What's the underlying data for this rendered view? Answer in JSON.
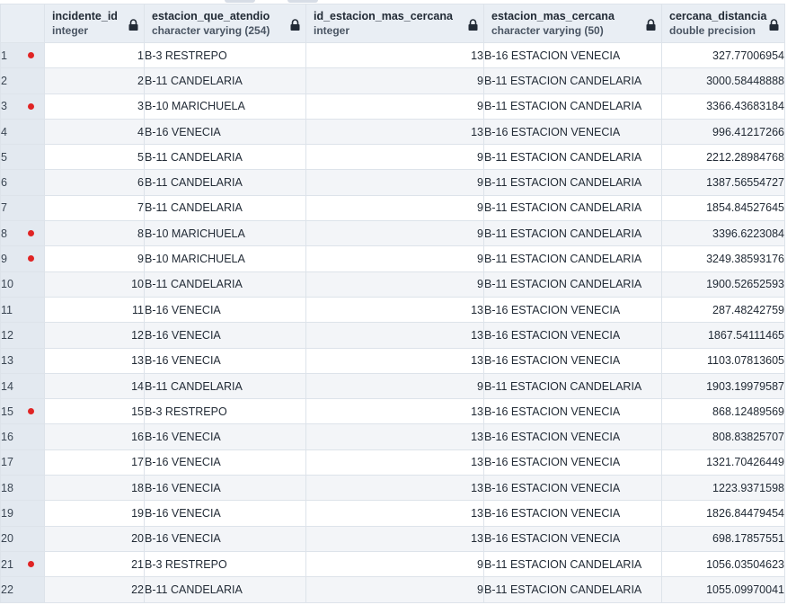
{
  "columns": [
    {
      "name": "incidente_id",
      "type": "integer"
    },
    {
      "name": "estacion_que_atendio",
      "type": "character varying (254)"
    },
    {
      "name": "id_estacion_mas_cercana",
      "type": "integer"
    },
    {
      "name": "estacion_mas_cercana",
      "type": "character varying (50)"
    },
    {
      "name": "cercana_distancia",
      "type": "double precision"
    }
  ],
  "header_icon": "lock-icon",
  "marker_color": "#e02424",
  "rows": [
    {
      "rownum": "1",
      "marked": true,
      "incidente_id": "1",
      "estacion_que_atendio": "B-3 RESTREPO",
      "id_estacion_mas_cercana": "13",
      "estacion_mas_cercana": "B-16 ESTACION VENECIA",
      "cercana_distancia": "327.77006954"
    },
    {
      "rownum": "2",
      "marked": false,
      "incidente_id": "2",
      "estacion_que_atendio": "B-11 CANDELARIA",
      "id_estacion_mas_cercana": "9",
      "estacion_mas_cercana": "B-11 ESTACION CANDELARIA",
      "cercana_distancia": "3000.58448888"
    },
    {
      "rownum": "3",
      "marked": true,
      "incidente_id": "3",
      "estacion_que_atendio": "B-10 MARICHUELA",
      "id_estacion_mas_cercana": "9",
      "estacion_mas_cercana": "B-11 ESTACION CANDELARIA",
      "cercana_distancia": "3366.43683184"
    },
    {
      "rownum": "4",
      "marked": false,
      "incidente_id": "4",
      "estacion_que_atendio": "B-16 VENECIA",
      "id_estacion_mas_cercana": "13",
      "estacion_mas_cercana": "B-16 ESTACION VENECIA",
      "cercana_distancia": "996.41217266"
    },
    {
      "rownum": "5",
      "marked": false,
      "incidente_id": "5",
      "estacion_que_atendio": "B-11 CANDELARIA",
      "id_estacion_mas_cercana": "9",
      "estacion_mas_cercana": "B-11 ESTACION CANDELARIA",
      "cercana_distancia": "2212.28984768"
    },
    {
      "rownum": "6",
      "marked": false,
      "incidente_id": "6",
      "estacion_que_atendio": "B-11 CANDELARIA",
      "id_estacion_mas_cercana": "9",
      "estacion_mas_cercana": "B-11 ESTACION CANDELARIA",
      "cercana_distancia": "1387.56554727"
    },
    {
      "rownum": "7",
      "marked": false,
      "incidente_id": "7",
      "estacion_que_atendio": "B-11 CANDELARIA",
      "id_estacion_mas_cercana": "9",
      "estacion_mas_cercana": "B-11 ESTACION CANDELARIA",
      "cercana_distancia": "1854.84527645"
    },
    {
      "rownum": "8",
      "marked": true,
      "incidente_id": "8",
      "estacion_que_atendio": "B-10 MARICHUELA",
      "id_estacion_mas_cercana": "9",
      "estacion_mas_cercana": "B-11 ESTACION CANDELARIA",
      "cercana_distancia": "3396.6223084"
    },
    {
      "rownum": "9",
      "marked": true,
      "incidente_id": "9",
      "estacion_que_atendio": "B-10 MARICHUELA",
      "id_estacion_mas_cercana": "9",
      "estacion_mas_cercana": "B-11 ESTACION CANDELARIA",
      "cercana_distancia": "3249.38593176"
    },
    {
      "rownum": "10",
      "marked": false,
      "incidente_id": "10",
      "estacion_que_atendio": "B-11 CANDELARIA",
      "id_estacion_mas_cercana": "9",
      "estacion_mas_cercana": "B-11 ESTACION CANDELARIA",
      "cercana_distancia": "1900.52652593"
    },
    {
      "rownum": "11",
      "marked": false,
      "incidente_id": "11",
      "estacion_que_atendio": "B-16 VENECIA",
      "id_estacion_mas_cercana": "13",
      "estacion_mas_cercana": "B-16 ESTACION VENECIA",
      "cercana_distancia": "287.48242759"
    },
    {
      "rownum": "12",
      "marked": false,
      "incidente_id": "12",
      "estacion_que_atendio": "B-16 VENECIA",
      "id_estacion_mas_cercana": "13",
      "estacion_mas_cercana": "B-16 ESTACION VENECIA",
      "cercana_distancia": "1867.54111465"
    },
    {
      "rownum": "13",
      "marked": false,
      "incidente_id": "13",
      "estacion_que_atendio": "B-16 VENECIA",
      "id_estacion_mas_cercana": "13",
      "estacion_mas_cercana": "B-16 ESTACION VENECIA",
      "cercana_distancia": "1103.07813605"
    },
    {
      "rownum": "14",
      "marked": false,
      "incidente_id": "14",
      "estacion_que_atendio": "B-11 CANDELARIA",
      "id_estacion_mas_cercana": "9",
      "estacion_mas_cercana": "B-11 ESTACION CANDELARIA",
      "cercana_distancia": "1903.19979587"
    },
    {
      "rownum": "15",
      "marked": true,
      "incidente_id": "15",
      "estacion_que_atendio": "B-3 RESTREPO",
      "id_estacion_mas_cercana": "13",
      "estacion_mas_cercana": "B-16 ESTACION VENECIA",
      "cercana_distancia": "868.12489569"
    },
    {
      "rownum": "16",
      "marked": false,
      "incidente_id": "16",
      "estacion_que_atendio": "B-16 VENECIA",
      "id_estacion_mas_cercana": "13",
      "estacion_mas_cercana": "B-16 ESTACION VENECIA",
      "cercana_distancia": "808.83825707"
    },
    {
      "rownum": "17",
      "marked": false,
      "incidente_id": "17",
      "estacion_que_atendio": "B-16 VENECIA",
      "id_estacion_mas_cercana": "13",
      "estacion_mas_cercana": "B-16 ESTACION VENECIA",
      "cercana_distancia": "1321.70426449"
    },
    {
      "rownum": "18",
      "marked": false,
      "incidente_id": "18",
      "estacion_que_atendio": "B-16 VENECIA",
      "id_estacion_mas_cercana": "13",
      "estacion_mas_cercana": "B-16 ESTACION VENECIA",
      "cercana_distancia": "1223.9371598"
    },
    {
      "rownum": "19",
      "marked": false,
      "incidente_id": "19",
      "estacion_que_atendio": "B-16 VENECIA",
      "id_estacion_mas_cercana": "13",
      "estacion_mas_cercana": "B-16 ESTACION VENECIA",
      "cercana_distancia": "1826.84479454"
    },
    {
      "rownum": "20",
      "marked": false,
      "incidente_id": "20",
      "estacion_que_atendio": "B-16 VENECIA",
      "id_estacion_mas_cercana": "13",
      "estacion_mas_cercana": "B-16 ESTACION VENECIA",
      "cercana_distancia": "698.17857551"
    },
    {
      "rownum": "21",
      "marked": true,
      "incidente_id": "21",
      "estacion_que_atendio": "B-3 RESTREPO",
      "id_estacion_mas_cercana": "9",
      "estacion_mas_cercana": "B-11 ESTACION CANDELARIA",
      "cercana_distancia": "1056.03504623"
    },
    {
      "rownum": "22",
      "marked": false,
      "incidente_id": "22",
      "estacion_que_atendio": "B-11 CANDELARIA",
      "id_estacion_mas_cercana": "9",
      "estacion_mas_cercana": "B-11 ESTACION CANDELARIA",
      "cercana_distancia": "1055.09970041"
    }
  ]
}
